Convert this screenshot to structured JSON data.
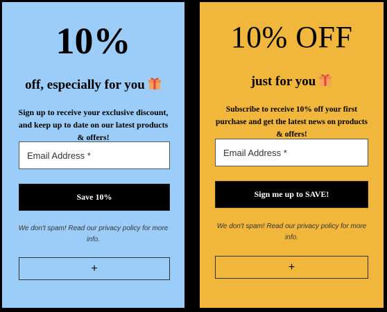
{
  "colors": {
    "blue_card": "#9ccdf8",
    "yellow_card": "#f0b73c",
    "button_bg": "#000000"
  },
  "cards": [
    {
      "headline": "10%",
      "subheadline": "off, especially for you",
      "sub_icon": "gift-icon",
      "description": "Sign up to receive your exclusive discount, and keep up to date on our latest products & offers!",
      "email_placeholder": "Email Address *",
      "button_label": "Save 10%",
      "privacy_note": "We don't spam! Read our privacy policy for more info.",
      "expand_label": "+"
    },
    {
      "headline": "10% OFF",
      "subheadline": "just for you",
      "sub_icon": "gift-icon",
      "description": "Subscribe to receive 10% off your first purchase and get the latest news on products & offers!",
      "email_placeholder": "Email Address *",
      "button_label": "Sign me up to SAVE!",
      "privacy_note": "We don't spam! Read our privacy policy for more info.",
      "expand_label": "+"
    }
  ]
}
